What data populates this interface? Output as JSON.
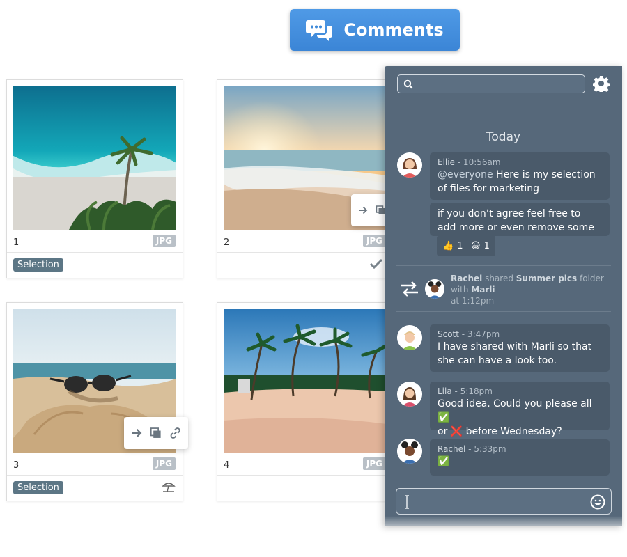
{
  "header": {
    "comments_label": "Comments"
  },
  "cards": [
    {
      "number": "1",
      "ext": "JPG",
      "tag": "Selection"
    },
    {
      "number": "2",
      "ext": "JPG",
      "tag": ""
    },
    {
      "number": "3",
      "ext": "JPG",
      "tag": "Selection"
    },
    {
      "number": "4",
      "ext": "JPG",
      "tag": ""
    }
  ],
  "chat": {
    "search_placeholder": "",
    "day_label": "Today",
    "messages": [
      {
        "author": "Ellie",
        "time": " - 10:56am",
        "mention": "@everyone",
        "text": " Here is my selection of files for marketing"
      },
      {
        "text": "if you don’t agree feel free to add more or even remove some"
      },
      {
        "author": "Scott",
        "time": " - 3:47pm",
        "text": "I have shared with Marli so that she can have a look too."
      },
      {
        "author": "Lila",
        "time": " - 5:18pm",
        "text_a": "Good idea. Could you please all ",
        "text_b": "or ",
        "text_c": " before Wednesday?"
      },
      {
        "author": "Rachel",
        "time": " - 5:33pm",
        "text": ""
      }
    ],
    "reactions": [
      {
        "emoji": "👍",
        "count": "1"
      },
      {
        "emoji": "😀",
        "count": "1"
      }
    ],
    "share_event": {
      "actor": "Rachel",
      "verb": " shared ",
      "object": "Summer pics",
      "suffix": " folder",
      "with_label": "with ",
      "with_name": "Marli",
      "time": "at 1:12pm"
    },
    "emoji_check": "✅",
    "emoji_cross": "❌"
  },
  "colors": {
    "accent": "#3b85d6",
    "panel_bg": "#56687a",
    "bubble_bg": "#4a5a6a",
    "tag_bg": "#5c7685"
  },
  "icons": [
    "comments-icon",
    "search-icon",
    "gear-icon",
    "arrow-right-icon",
    "copy-icon",
    "link-icon",
    "check-icon",
    "beach-umbrella-icon",
    "swap-icon",
    "smiley-icon",
    "text-cursor-icon"
  ]
}
